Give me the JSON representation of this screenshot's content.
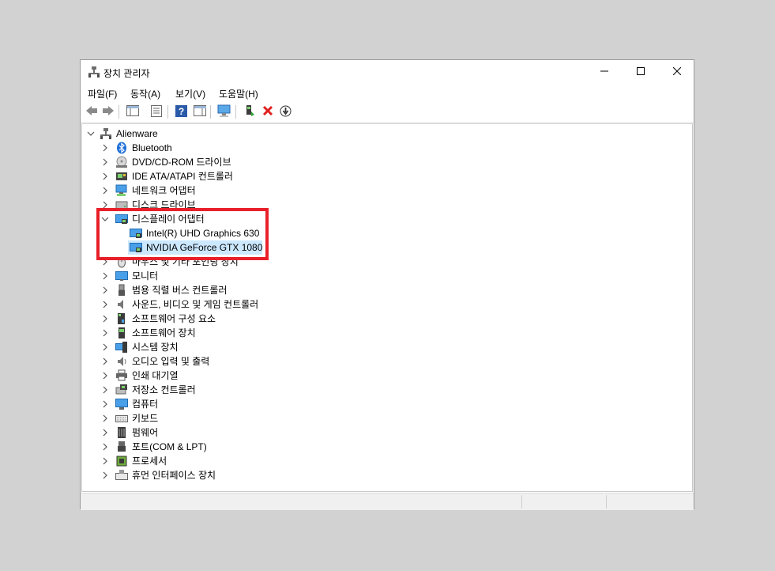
{
  "window": {
    "title": "장치 관리자",
    "minimize_icon": "minimize-icon",
    "maximize_icon": "maximize-icon",
    "close_icon": "close-icon"
  },
  "menu": [
    {
      "label": "파일(F)"
    },
    {
      "label": "동작(A)"
    },
    {
      "label": "보기(V)"
    },
    {
      "label": "도움말(H)"
    }
  ],
  "toolbar": [
    {
      "icon": "back-arrow-icon"
    },
    {
      "icon": "forward-arrow-icon"
    },
    {
      "icon": "show-hide-console-tree-icon"
    },
    {
      "icon": "properties-icon"
    },
    {
      "icon": "help-icon"
    },
    {
      "icon": "action-pane-icon"
    },
    {
      "icon": "scan-hardware-icon"
    },
    {
      "icon": "update-driver-icon"
    },
    {
      "icon": "uninstall-device-icon"
    },
    {
      "icon": "disable-device-icon"
    }
  ],
  "tree": {
    "root": {
      "label": "Alienware",
      "icon": "computer-icon",
      "expanded": true
    },
    "items": [
      {
        "label": "Bluetooth",
        "icon": "bluetooth-icon",
        "expanded": false
      },
      {
        "label": "DVD/CD-ROM 드라이브",
        "icon": "dvd-drive-icon",
        "expanded": false
      },
      {
        "label": "IDE ATA/ATAPI 컨트롤러",
        "icon": "ide-controller-icon",
        "expanded": false
      },
      {
        "label": "네트워크 어댑터",
        "icon": "network-adapter-icon",
        "expanded": false
      },
      {
        "label": "디스크 드라이브",
        "icon": "disk-drive-icon",
        "expanded": false
      },
      {
        "label": "디스플레이 어댑터",
        "icon": "display-adapter-icon",
        "expanded": true,
        "children": [
          {
            "label": "Intel(R) UHD Graphics 630",
            "icon": "display-adapter-icon",
            "selected": false
          },
          {
            "label": "NVIDIA GeForce GTX 1080",
            "icon": "display-adapter-icon",
            "selected": true
          }
        ]
      },
      {
        "label": "마우스 및 기타 포인팅 장치",
        "icon": "mouse-icon",
        "expanded": false
      },
      {
        "label": "모니터",
        "icon": "monitor-icon",
        "expanded": false
      },
      {
        "label": "범용 직렬 버스 컨트롤러",
        "icon": "usb-icon",
        "expanded": false
      },
      {
        "label": "사운드, 비디오 및 게임 컨트롤러",
        "icon": "speaker-icon",
        "expanded": false
      },
      {
        "label": "소프트웨어 구성 요소",
        "icon": "software-component-icon",
        "expanded": false
      },
      {
        "label": "소프트웨어 장치",
        "icon": "software-device-icon",
        "expanded": false
      },
      {
        "label": "시스템 장치",
        "icon": "system-device-icon",
        "expanded": false
      },
      {
        "label": "오디오 입력 및 출력",
        "icon": "audio-io-icon",
        "expanded": false
      },
      {
        "label": "인쇄 대기열",
        "icon": "printer-icon",
        "expanded": false
      },
      {
        "label": "저장소 컨트롤러",
        "icon": "storage-controller-icon",
        "expanded": false
      },
      {
        "label": "컴퓨터",
        "icon": "computer-monitor-icon",
        "expanded": false
      },
      {
        "label": "키보드",
        "icon": "keyboard-icon",
        "expanded": false
      },
      {
        "label": "펌웨어",
        "icon": "firmware-icon",
        "expanded": false
      },
      {
        "label": "포트(COM & LPT)",
        "icon": "port-icon",
        "expanded": false
      },
      {
        "label": "프로세서",
        "icon": "processor-icon",
        "expanded": false
      },
      {
        "label": "휴먼 인터페이스 장치",
        "icon": "hid-icon",
        "expanded": false
      }
    ]
  },
  "colors": {
    "highlight_border": "#e8202a",
    "selection_bg": "#cce8ff"
  }
}
